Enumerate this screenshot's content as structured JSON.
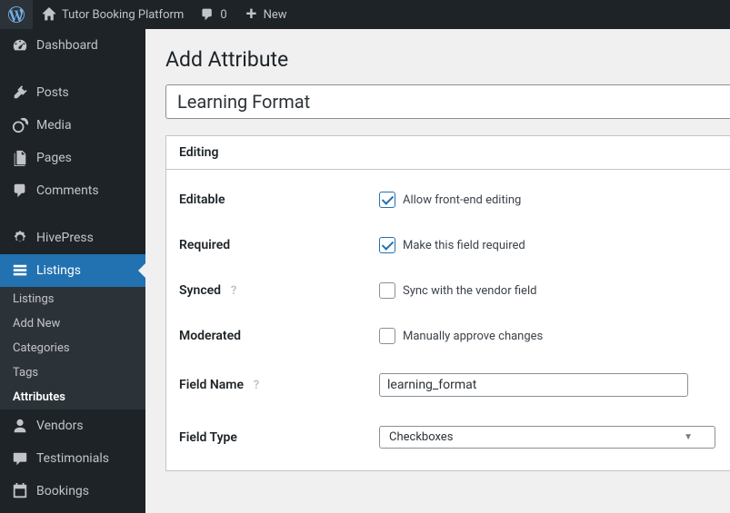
{
  "topbar": {
    "site_name": "Tutor Booking Platform",
    "comments_count": "0",
    "new_label": "New"
  },
  "sidebar": {
    "items": [
      {
        "label": "Dashboard"
      },
      {
        "label": "Posts"
      },
      {
        "label": "Media"
      },
      {
        "label": "Pages"
      },
      {
        "label": "Comments"
      },
      {
        "label": "HivePress"
      },
      {
        "label": "Listings"
      },
      {
        "label": "Vendors"
      },
      {
        "label": "Testimonials"
      },
      {
        "label": "Bookings"
      }
    ],
    "submenu": [
      {
        "label": "Listings"
      },
      {
        "label": "Add New"
      },
      {
        "label": "Categories"
      },
      {
        "label": "Tags"
      },
      {
        "label": "Attributes"
      }
    ]
  },
  "page": {
    "title": "Add Attribute",
    "attribute_name": "Learning Format"
  },
  "panel": {
    "heading": "Editing",
    "rows": {
      "editable": {
        "label": "Editable",
        "option": "Allow front-end editing",
        "checked": true
      },
      "required": {
        "label": "Required",
        "option": "Make this field required",
        "checked": true
      },
      "synced": {
        "label": "Synced",
        "option": "Sync with the vendor field",
        "checked": false
      },
      "moderated": {
        "label": "Moderated",
        "option": "Manually approve changes",
        "checked": false
      },
      "field_name": {
        "label": "Field Name",
        "value": "learning_format"
      },
      "field_type": {
        "label": "Field Type",
        "value": "Checkboxes"
      }
    }
  }
}
